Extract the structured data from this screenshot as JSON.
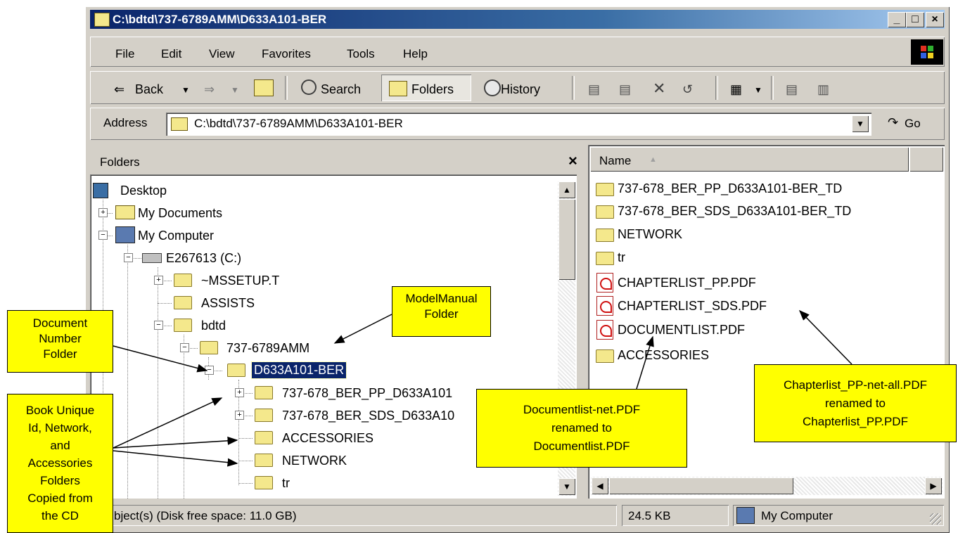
{
  "window": {
    "title": "C:\\bdtd\\737-6789AMM\\D633A101-BER"
  },
  "menu": [
    "File",
    "Edit",
    "View",
    "Favorites",
    "Tools",
    "Help"
  ],
  "toolbar": {
    "back": "Back",
    "search": "Search",
    "folders": "Folders",
    "history": "History"
  },
  "address": {
    "label": "Address",
    "value": "C:\\bdtd\\737-6789AMM\\D633A101-BER",
    "go": "Go"
  },
  "folders_pane": {
    "title": "Folders",
    "close": "×",
    "items": [
      "Desktop",
      "My Documents",
      "My Computer",
      "E267613 (C:)",
      "~MSSETUP.T",
      "ASSISTS",
      "bdtd",
      "737-6789AMM",
      "D633A101-BER",
      "737-678_BER_PP_D633A101",
      "737-678_BER_SDS_D633A10",
      "ACCESSORIES",
      "NETWORK",
      "tr"
    ]
  },
  "list_pane": {
    "column_name": "Name",
    "items": [
      {
        "name": "737-678_BER_PP_D633A101-BER_TD",
        "type": "folder"
      },
      {
        "name": "737-678_BER_SDS_D633A101-BER_TD",
        "type": "folder"
      },
      {
        "name": "NETWORK",
        "type": "folder"
      },
      {
        "name": "tr",
        "type": "folder"
      },
      {
        "name": "CHAPTERLIST_PP.PDF",
        "type": "pdf"
      },
      {
        "name": "CHAPTERLIST_SDS.PDF",
        "type": "pdf"
      },
      {
        "name": "DOCUMENTLIST.PDF",
        "type": "pdf"
      },
      {
        "name": "ACCESSORIES",
        "type": "folder"
      }
    ]
  },
  "status": {
    "objects": "bject(s) (Disk free space: 11.0 GB)",
    "size": "24.5 KB",
    "zone": "My Computer"
  },
  "callouts": {
    "model_manual_1": "ModelManual",
    "model_manual_2": "Folder",
    "doc_number_1": "Document",
    "doc_number_2": "Number",
    "doc_number_3": "Folder",
    "book_1": "Book Unique",
    "book_2": "Id, Network,",
    "book_3": "and",
    "book_4": "Accessories",
    "book_5": "Folders",
    "book_6": "Copied from",
    "book_7": "the CD",
    "doclist_1": "Documentlist-net.PDF",
    "doclist_2": "renamed to",
    "doclist_3": "Documentlist.PDF",
    "chapter_1": "Chapterlist_PP-net-all.PDF",
    "chapter_2": "renamed to",
    "chapter_3": "Chapterlist_PP.PDF"
  },
  "colors": {
    "titlebar": "#0a246a",
    "selection": "#0a246a",
    "callout": "#ffff00",
    "chrome": "#d4d0c8"
  }
}
